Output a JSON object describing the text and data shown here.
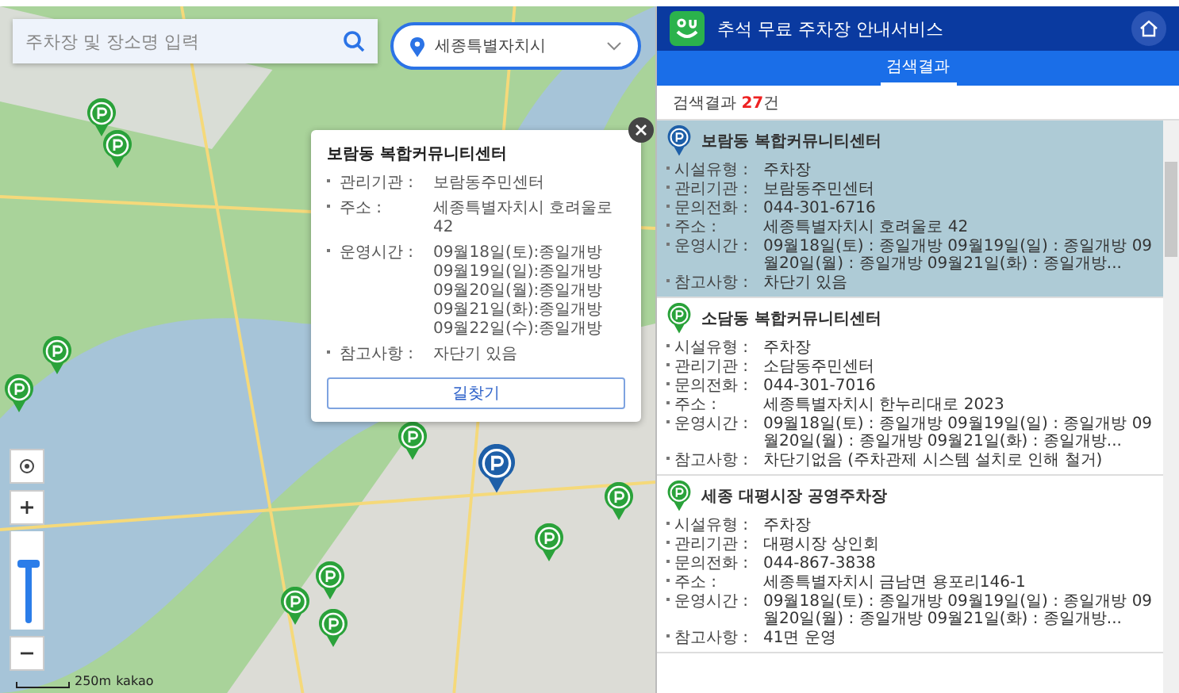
{
  "search": {
    "placeholder": "주차장 및 장소명 입력"
  },
  "region": {
    "value": "세종특별자치시"
  },
  "map": {
    "zoom_level": {
      "level": 0.7
    },
    "scale": "250m",
    "attribution": "kakao",
    "markers": [
      {
        "selected": false
      },
      {
        "selected": false
      },
      {
        "selected": false
      },
      {
        "selected": false
      },
      {
        "selected": false
      },
      {
        "selected": false
      },
      {
        "selected": false
      },
      {
        "selected": false
      },
      {
        "selected": false
      },
      {
        "selected": false
      },
      {
        "selected": true
      }
    ]
  },
  "popup": {
    "title": "보람동 복합커뮤니티센터",
    "fields": [
      {
        "label": "관리기관 :",
        "lines": [
          "보람동주민센터"
        ]
      },
      {
        "label": "주소 :",
        "lines": [
          "세종특별자치시 호려울로 42"
        ]
      },
      {
        "label": "운영시간 :",
        "lines": [
          "09월18일(토):종일개방",
          "09월19일(일):종일개방",
          "09월20일(월):종일개방",
          "09월21일(화):종일개방",
          "09월22일(수):종일개방"
        ]
      },
      {
        "label": "참고사항 :",
        "lines": [
          "자단기 있음"
        ]
      }
    ],
    "button": "길찾기"
  },
  "panel": {
    "title": "추석 무료 주차장 안내서비스",
    "tabs": [
      {
        "label": "검색결과",
        "selected": true
      }
    ],
    "count": {
      "prefix": "검색결과",
      "number": "27",
      "suffix": "건"
    },
    "results": [
      {
        "title": "보람동 복합커뮤니티센터",
        "selected": true,
        "fields": [
          {
            "label": "시설유형 :",
            "value": "주차장"
          },
          {
            "label": "관리기관 :",
            "value": "보람동주민센터"
          },
          {
            "label": "문의전화 :",
            "value": "044-301-6716"
          },
          {
            "label": "주소 :",
            "value": "세종특별자치시 호려울로 42"
          },
          {
            "label": "운영시간 :",
            "value": "09월18일(토) : 종일개방 09월19일(일) : 종일개방 09월20일(월) : 종일개방 09월21일(화) : 종일개방..."
          },
          {
            "label": "참고사항 :",
            "value": "차단기 있음"
          }
        ]
      },
      {
        "title": "소담동 복합커뮤니티센터",
        "selected": false,
        "fields": [
          {
            "label": "시설유형 :",
            "value": "주차장"
          },
          {
            "label": "관리기관 :",
            "value": "소담동주민센터"
          },
          {
            "label": "문의전화 :",
            "value": "044-301-7016"
          },
          {
            "label": "주소 :",
            "value": "세종특별자치시 한누리대로 2023"
          },
          {
            "label": "운영시간 :",
            "value": "09월18일(토) : 종일개방 09월19일(일) : 종일개방 09월20일(월) : 종일개방 09월21일(화) : 종일개방..."
          },
          {
            "label": "참고사항 :",
            "value": "차단기없음 (주차관제 시스템 설치로 인해 철거)"
          }
        ]
      },
      {
        "title": "세종 대평시장 공영주차장",
        "selected": false,
        "fields": [
          {
            "label": "시설유형 :",
            "value": "주차장"
          },
          {
            "label": "관리기관 :",
            "value": "대평시장 상인회"
          },
          {
            "label": "문의전화 :",
            "value": "044-867-3838"
          },
          {
            "label": "주소 :",
            "value": "세종특별자치시 금남면 용포리146-1"
          },
          {
            "label": "운영시간 :",
            "value": "09월18일(토) : 종일개방 09월19일(일) : 종일개방 09월20일(월) : 종일개방 09월21일(화) : 종일개방..."
          },
          {
            "label": "참고사항 :",
            "value": "41면 운영"
          }
        ]
      }
    ]
  }
}
